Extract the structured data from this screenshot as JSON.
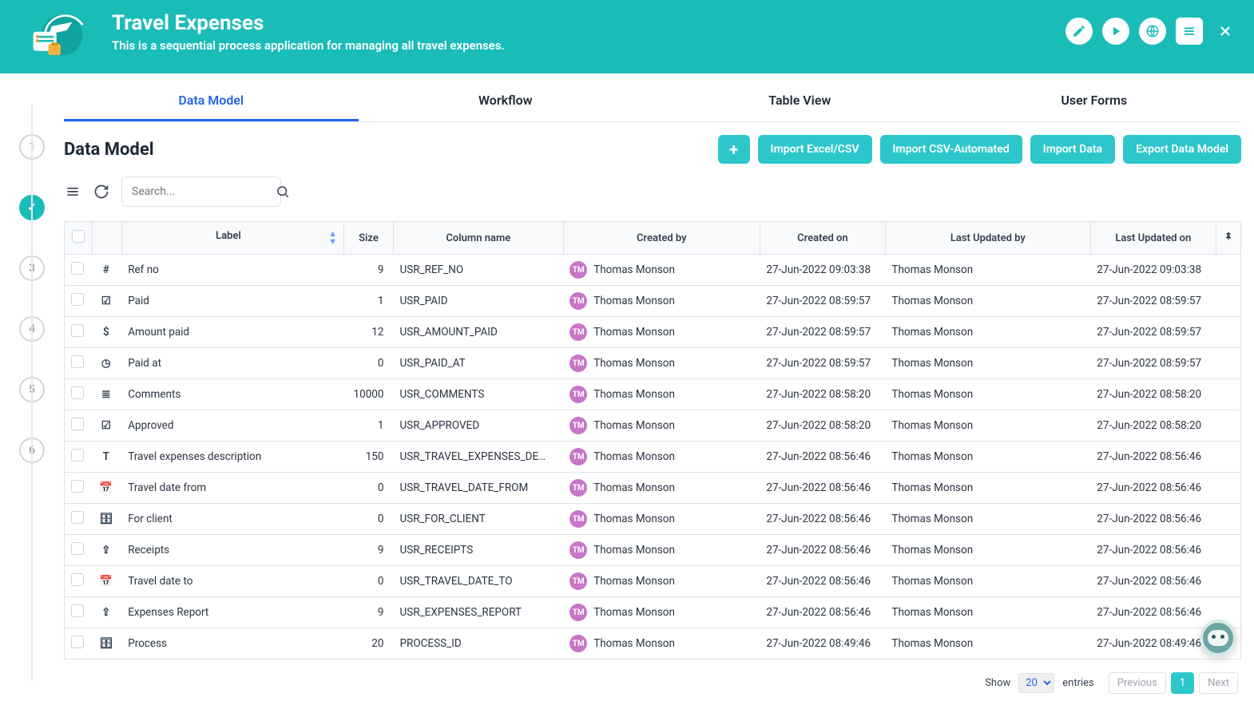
{
  "header": {
    "title": "Travel Expenses",
    "subtitle": "This is a sequential process application for managing all travel expenses."
  },
  "rail": {
    "steps": [
      "1",
      "",
      "3",
      "4",
      "5",
      "6"
    ],
    "active_index": 1,
    "active_glyph": "✓"
  },
  "tabs": [
    {
      "label": "Data Model",
      "active": true
    },
    {
      "label": "Workflow",
      "active": false
    },
    {
      "label": "Table View",
      "active": false
    },
    {
      "label": "User Forms",
      "active": false
    }
  ],
  "section": {
    "title": "Data Model"
  },
  "buttons": {
    "add": "+",
    "import_excel": "Import Excel/CSV",
    "import_auto": "Import CSV-Automated",
    "import_data": "Import Data",
    "export": "Export Data Model"
  },
  "search": {
    "placeholder": "Search..."
  },
  "columns": {
    "label": "Label",
    "size": "Size",
    "column": "Column name",
    "created_by": "Created by",
    "created_on": "Created on",
    "updated_by": "Last Updated by",
    "updated_on": "Last Updated on"
  },
  "avatar_initials": "TM",
  "rows": [
    {
      "icon": "#",
      "label": "Ref no",
      "size": 9,
      "column": "USR_REF_NO",
      "created_by": "Thomas Monson",
      "created_on": "27-Jun-2022 09:03:38",
      "updated_by": "Thomas Monson",
      "updated_on": "27-Jun-2022 09:03:38"
    },
    {
      "icon": "☑",
      "label": "Paid",
      "size": 1,
      "column": "USR_PAID",
      "created_by": "Thomas Monson",
      "created_on": "27-Jun-2022 08:59:57",
      "updated_by": "Thomas Monson",
      "updated_on": "27-Jun-2022 08:59:57"
    },
    {
      "icon": "$",
      "label": "Amount paid",
      "size": 12,
      "column": "USR_AMOUNT_PAID",
      "created_by": "Thomas Monson",
      "created_on": "27-Jun-2022 08:59:57",
      "updated_by": "Thomas Monson",
      "updated_on": "27-Jun-2022 08:59:57"
    },
    {
      "icon": "◷",
      "label": "Paid at",
      "size": 0,
      "column": "USR_PAID_AT",
      "created_by": "Thomas Monson",
      "created_on": "27-Jun-2022 08:59:57",
      "updated_by": "Thomas Monson",
      "updated_on": "27-Jun-2022 08:59:57"
    },
    {
      "icon": "≣",
      "label": "Comments",
      "size": 10000,
      "column": "USR_COMMENTS",
      "created_by": "Thomas Monson",
      "created_on": "27-Jun-2022 08:58:20",
      "updated_by": "Thomas Monson",
      "updated_on": "27-Jun-2022 08:58:20"
    },
    {
      "icon": "☑",
      "label": "Approved",
      "size": 1,
      "column": "USR_APPROVED",
      "created_by": "Thomas Monson",
      "created_on": "27-Jun-2022 08:58:20",
      "updated_by": "Thomas Monson",
      "updated_on": "27-Jun-2022 08:58:20"
    },
    {
      "icon": "T",
      "label": "Travel expenses description",
      "size": 150,
      "column": "USR_TRAVEL_EXPENSES_DE…",
      "created_by": "Thomas Monson",
      "created_on": "27-Jun-2022 08:56:46",
      "updated_by": "Thomas Monson",
      "updated_on": "27-Jun-2022 08:56:46"
    },
    {
      "icon": "📅",
      "label": "Travel date from",
      "size": 0,
      "column": "USR_TRAVEL_DATE_FROM",
      "created_by": "Thomas Monson",
      "created_on": "27-Jun-2022 08:56:46",
      "updated_by": "Thomas Monson",
      "updated_on": "27-Jun-2022 08:56:46"
    },
    {
      "icon": "🗄",
      "label": "For client",
      "size": 0,
      "column": "USR_FOR_CLIENT",
      "created_by": "Thomas Monson",
      "created_on": "27-Jun-2022 08:56:46",
      "updated_by": "Thomas Monson",
      "updated_on": "27-Jun-2022 08:56:46"
    },
    {
      "icon": "⇪",
      "label": "Receipts",
      "size": 9,
      "column": "USR_RECEIPTS",
      "created_by": "Thomas Monson",
      "created_on": "27-Jun-2022 08:56:46",
      "updated_by": "Thomas Monson",
      "updated_on": "27-Jun-2022 08:56:46"
    },
    {
      "icon": "📅",
      "label": "Travel date to",
      "size": 0,
      "column": "USR_TRAVEL_DATE_TO",
      "created_by": "Thomas Monson",
      "created_on": "27-Jun-2022 08:56:46",
      "updated_by": "Thomas Monson",
      "updated_on": "27-Jun-2022 08:56:46"
    },
    {
      "icon": "⇪",
      "label": "Expenses Report",
      "size": 9,
      "column": "USR_EXPENSES_REPORT",
      "created_by": "Thomas Monson",
      "created_on": "27-Jun-2022 08:56:46",
      "updated_by": "Thomas Monson",
      "updated_on": "27-Jun-2022 08:56:46"
    },
    {
      "icon": "🗄",
      "label": "Process",
      "size": 20,
      "column": "PROCESS_ID",
      "created_by": "Thomas Monson",
      "created_on": "27-Jun-2022 08:49:46",
      "updated_by": "Thomas Monson",
      "updated_on": "27-Jun-2022 08:49:46"
    }
  ],
  "footer": {
    "show": "Show",
    "page_size": "20",
    "entries": "entries",
    "previous": "Previous",
    "page": "1",
    "next": "Next"
  }
}
